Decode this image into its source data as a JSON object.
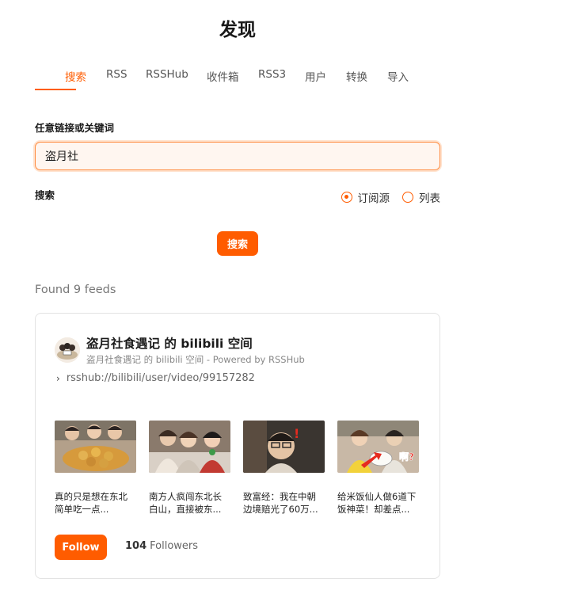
{
  "page": {
    "title": "发现"
  },
  "tabs": [
    {
      "label": "搜索",
      "active": true
    },
    {
      "label": "RSS"
    },
    {
      "label": "RSSHub"
    },
    {
      "label": "收件箱"
    },
    {
      "label": "RSS3"
    },
    {
      "label": "用户"
    },
    {
      "label": "转换"
    },
    {
      "label": "导入"
    }
  ],
  "form": {
    "keyword_label": "任意链接或关键词",
    "keyword_value": "盗月社",
    "mode_label": "搜索",
    "modes": [
      {
        "label": "订阅源",
        "checked": true
      },
      {
        "label": "列表",
        "checked": false
      }
    ],
    "search_button": "搜索"
  },
  "results": {
    "summary": "Found 9 feeds",
    "feeds": [
      {
        "title": "盗月社食遇记 的 bilibili 空间",
        "subtitle": "盗月社食遇记 的 bilibili 空间 - Powered by RSSHub",
        "url": "rsshub://bilibili/user/video/99157282",
        "entries": [
          {
            "title": "真的只是想在东北简单吃一点..."
          },
          {
            "title": "南方人疯闯东北长白山，直接被东..."
          },
          {
            "title": "致富经：我在中朝边境赔光了60万..."
          },
          {
            "title": "给米饭仙人做6道下饭神菜！却差点..."
          }
        ],
        "follow_button": "Follow",
        "followers_count": "104",
        "followers_label": "Followers"
      }
    ]
  },
  "colors": {
    "accent": "#ff5c00",
    "input_bg": "#fff6f0"
  }
}
